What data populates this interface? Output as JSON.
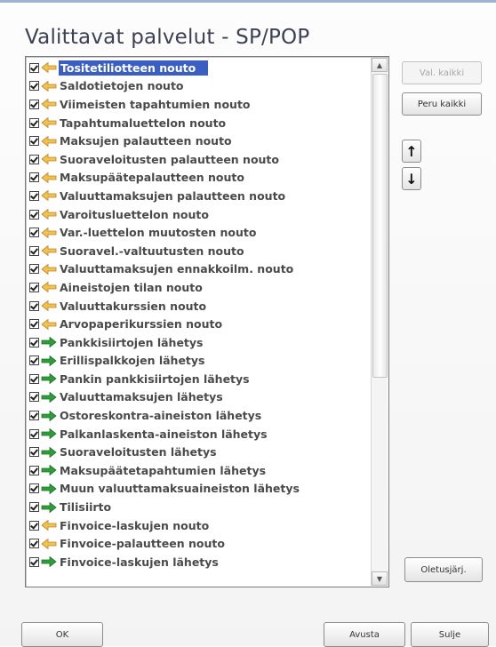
{
  "dialog": {
    "title": "Valittavat palvelut - SP/POP"
  },
  "buttons": {
    "select_all": "Val. kaikki",
    "deselect_all": "Peru kaikki",
    "move_up": "↑",
    "move_down": "↓",
    "default_order": "Oletusjärj.",
    "ok": "OK",
    "help": "Avusta",
    "close": "Sulje"
  },
  "scrollbar": {
    "up": "▲",
    "down": "▼"
  },
  "services": [
    {
      "label": "Tositetiliotteen nouto",
      "checked": true,
      "icon": "download-arrow-icon",
      "selected": true
    },
    {
      "label": "Saldotietojen nouto",
      "checked": true,
      "icon": "download-arrow-icon"
    },
    {
      "label": "Viimeisten tapahtumien nouto",
      "checked": true,
      "icon": "download-arrow-icon"
    },
    {
      "label": "Tapahtumaluettelon nouto",
      "checked": true,
      "icon": "download-arrow-icon"
    },
    {
      "label": "Maksujen palautteen nouto",
      "checked": true,
      "icon": "download-arrow-icon"
    },
    {
      "label": "Suoraveloitusten palautteen nouto",
      "checked": true,
      "icon": "download-arrow-icon"
    },
    {
      "label": "Maksupäätepalautteen nouto",
      "checked": true,
      "icon": "download-arrow-icon"
    },
    {
      "label": "Valuuttamaksujen palautteen nouto",
      "checked": true,
      "icon": "download-arrow-icon"
    },
    {
      "label": "Varoitusluettelon nouto",
      "checked": true,
      "icon": "download-arrow-icon"
    },
    {
      "label": "Var.-luettelon muutosten nouto",
      "checked": true,
      "icon": "download-arrow-icon"
    },
    {
      "label": "Suoravel.-valtuutusten nouto",
      "checked": true,
      "icon": "download-arrow-icon"
    },
    {
      "label": "Valuuttamaksujen ennakkoilm. nouto",
      "checked": true,
      "icon": "download-arrow-icon"
    },
    {
      "label": "Aineistojen tilan nouto",
      "checked": true,
      "icon": "download-arrow-icon"
    },
    {
      "label": "Valuuttakurssien nouto",
      "checked": true,
      "icon": "download-arrow-icon"
    },
    {
      "label": "Arvopaperikurssien nouto",
      "checked": true,
      "icon": "download-arrow-icon"
    },
    {
      "label": "Pankkisiirtojen lähetys",
      "checked": true,
      "icon": "upload-arrow-icon"
    },
    {
      "label": "Erillispalkkojen lähetys",
      "checked": true,
      "icon": "upload-arrow-icon"
    },
    {
      "label": "Pankin pankkisiirtojen lähetys",
      "checked": true,
      "icon": "upload-arrow-icon"
    },
    {
      "label": "Valuuttamaksujen lähetys",
      "checked": true,
      "icon": "upload-arrow-icon"
    },
    {
      "label": "Ostoreskontra-aineiston lähetys",
      "checked": true,
      "icon": "upload-arrow-icon"
    },
    {
      "label": "Palkanlaskenta-aineiston lähetys",
      "checked": true,
      "icon": "upload-arrow-icon"
    },
    {
      "label": "Suoraveloitusten lähetys",
      "checked": true,
      "icon": "upload-arrow-icon"
    },
    {
      "label": "Maksupäätetapahtumien lähetys",
      "checked": true,
      "icon": "upload-arrow-icon"
    },
    {
      "label": "Muun valuuttamaksuaineiston lähetys",
      "checked": true,
      "icon": "upload-arrow-icon"
    },
    {
      "label": "Tilisiirto",
      "checked": true,
      "icon": "upload-arrow-icon"
    },
    {
      "label": "Finvoice-laskujen nouto",
      "checked": true,
      "icon": "download-arrow-icon"
    },
    {
      "label": "Finvoice-palautteen nouto",
      "checked": true,
      "icon": "download-arrow-icon"
    },
    {
      "label": "Finvoice-laskujen lähetys",
      "checked": true,
      "icon": "upload-arrow-icon"
    }
  ],
  "colors": {
    "selection": "#3b5ec3",
    "download_arrow": "#f2c14e",
    "upload_arrow": "#2e9e3a"
  }
}
